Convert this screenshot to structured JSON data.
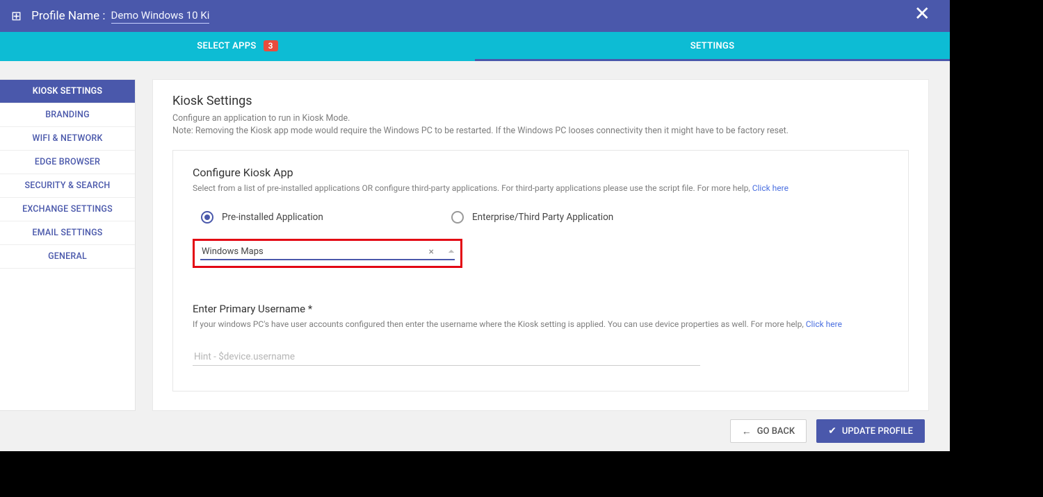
{
  "header": {
    "profile_label": "Profile Name :",
    "profile_name": "Demo Windows 10 Ki"
  },
  "tabs": {
    "select_apps": "SELECT APPS",
    "select_apps_badge": "3",
    "settings": "SETTINGS"
  },
  "sidebar": {
    "items": [
      "KIOSK SETTINGS",
      "BRANDING",
      "WIFI & NETWORK",
      "EDGE BROWSER",
      "SECURITY & SEARCH",
      "EXCHANGE SETTINGS",
      "EMAIL SETTINGS",
      "GENERAL"
    ]
  },
  "main": {
    "title": "Kiosk Settings",
    "subtitle": "Configure an application to run in Kiosk Mode.",
    "note": "Note: Removing the Kiosk app mode would require the Windows PC to be restarted. If the Windows PC looses connectivity then it might have to be factory reset.",
    "configure_title": "Configure Kiosk App",
    "configure_desc": "Select from a list of pre-installed applications OR configure third-party applications. For third-party applications please use the script file. For more help, ",
    "configure_link": "Click here",
    "radio_preinstalled": "Pre-installed Application",
    "radio_3rdparty": "Enterprise/Third Party Application",
    "selected_app": "Windows Maps",
    "username_title": "Enter Primary Username *",
    "username_help": "If your windows PC's have user accounts configured then enter the username where the Kiosk setting is applied. You can use device properties as well. For more help, ",
    "username_link": "Click here",
    "username_placeholder": "Hint - $device.username"
  },
  "footer": {
    "back": "GO BACK",
    "update": "UPDATE PROFILE"
  }
}
